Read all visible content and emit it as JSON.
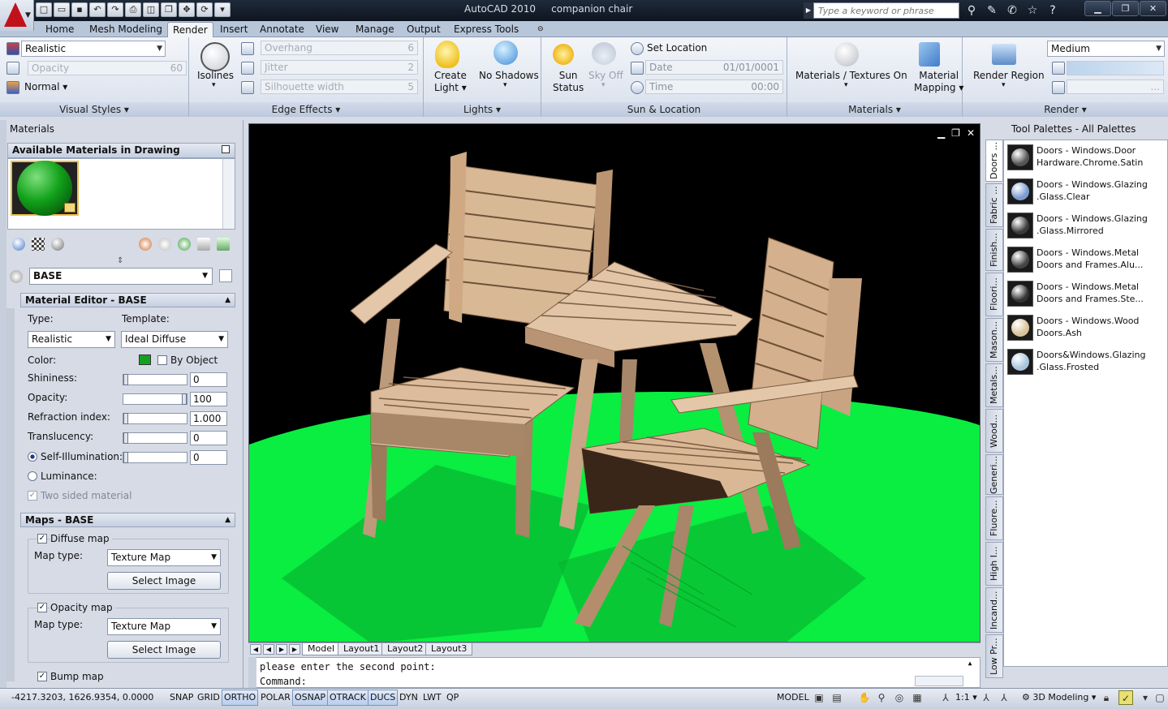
{
  "app": {
    "title": "AutoCAD 2010",
    "document": "companion chair"
  },
  "search": {
    "placeholder": "Type a keyword or phrase"
  },
  "ribbon_tabs": [
    "Home",
    "Mesh Modeling",
    "Render",
    "Insert",
    "Annotate",
    "View",
    "Manage",
    "Output",
    "Express Tools"
  ],
  "ribbon": {
    "visual_styles": {
      "style": "Realistic",
      "opacity_label": "Opacity",
      "opacity": "60",
      "face_mode": "Normal",
      "title": "Visual Styles"
    },
    "isolines": "Isolines",
    "edge_effects": {
      "overhang": "Overhang",
      "overhang_val": "6",
      "jitter": "Jitter",
      "jitter_val": "2",
      "silhouette": "Silhouette width",
      "silhouette_val": "5",
      "title": "Edge Effects"
    },
    "lights": {
      "create": "Create\nLight",
      "create_l1": "Create",
      "create_l2": "Light",
      "shadows": "No Shadows",
      "title": "Lights"
    },
    "sun": {
      "status_l1": "Sun",
      "status_l2": "Status",
      "sky": "Sky Off",
      "set_location": "Set Location",
      "date_label": "Date",
      "date": "01/01/0001",
      "time_label": "Time",
      "time": "00:00",
      "title": "Sun & Location"
    },
    "materials": {
      "textures": "Materials / Textures On",
      "mapping_l1": "Material",
      "mapping_l2": "Mapping",
      "title": "Materials"
    },
    "render": {
      "region": "Render Region",
      "quality": "Medium",
      "title": "Render"
    }
  },
  "materials_palette": {
    "title": "Materials",
    "available_header": "Available Materials in Drawing",
    "current": "BASE",
    "editor": {
      "header": "Material Editor - BASE",
      "type_label": "Type:",
      "template_label": "Template:",
      "type": "Realistic",
      "template": "Ideal Diffuse",
      "color_label": "Color:",
      "by_object": "By Object",
      "shininess_label": "Shininess:",
      "shininess": "0",
      "opacity_label": "Opacity:",
      "opacity": "100",
      "refraction_label": "Refraction index:",
      "refraction": "1.000",
      "translucency_label": "Translucency:",
      "translucency": "0",
      "self_illum_label": "Self-Illumination:",
      "self_illum": "0",
      "luminance_label": "Luminance:",
      "two_sided": "Two sided material"
    },
    "maps": {
      "header": "Maps - BASE",
      "diffuse": "Diffuse map",
      "opacity": "Opacity map",
      "bump": "Bump map",
      "map_type_label": "Map type:",
      "map_type": "Texture Map",
      "select_image": "Select Image"
    }
  },
  "layout_tabs": [
    "Model",
    "Layout1",
    "Layout2",
    "Layout3"
  ],
  "command": {
    "line1": "please enter the second point:",
    "line2": "Command:"
  },
  "tool_palettes": {
    "title": "Tool Palettes - All Palettes",
    "tabs": [
      "Doors ...",
      "Fabric ...",
      "Finish...",
      "Floori...",
      "Mason...",
      "Metals...",
      "Wood...",
      "Generi...",
      "Fluore...",
      "High I...",
      "Incand...",
      "Low Pr..."
    ],
    "items": [
      {
        "l1": "Doors - Windows.Door",
        "l2": "Hardware.Chrome.Satin",
        "color": "#555"
      },
      {
        "l1": "Doors - Windows.Glazing",
        "l2": ".Glass.Clear",
        "color": "#7a9ad0"
      },
      {
        "l1": "Doors - Windows.Glazing",
        "l2": ".Glass.Mirrored",
        "color": "#3a3a3a"
      },
      {
        "l1": "Doors - Windows.Metal",
        "l2": "Doors and Frames.Alu...",
        "color": "#444"
      },
      {
        "l1": "Doors - Windows.Metal",
        "l2": "Doors and Frames.Ste...",
        "color": "#333"
      },
      {
        "l1": "Doors - Windows.Wood",
        "l2": "Doors.Ash",
        "color": "#d8c29a"
      },
      {
        "l1": "Doors&Windows.Glazing",
        "l2": ".Glass.Frosted",
        "color": "#a8c4dc"
      }
    ]
  },
  "status": {
    "coords": "-4217.3203, 1626.9354, 0.0000",
    "toggles": [
      "SNAP",
      "GRID",
      "ORTHO",
      "POLAR",
      "OSNAP",
      "OTRACK",
      "DUCS",
      "DYN",
      "LWT",
      "QP"
    ],
    "model": "MODEL",
    "scale": "1:1",
    "workspace": "3D Modeling"
  }
}
